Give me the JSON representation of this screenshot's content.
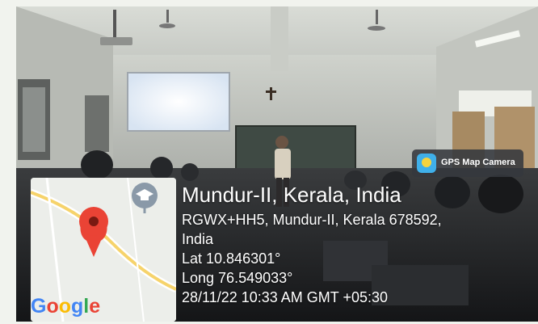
{
  "overlay": {
    "badge_label": "GPS Map Camera",
    "location_title": "Mundur-II, Kerala, India",
    "address_line1": "RGWX+HH5, Mundur-II, Kerala 678592,",
    "address_line2": "India",
    "latitude": "Lat 10.846301°",
    "longitude": "Long 76.549033°",
    "datetime": "28/11/22 10:33 AM GMT +05:30"
  },
  "map": {
    "logo_text": "Google",
    "logo_letters": [
      "G",
      "o",
      "o",
      "g",
      "l",
      "e"
    ],
    "logo_colors": [
      "#4285f4",
      "#ea4335",
      "#fbbc05",
      "#4285f4",
      "#34a853",
      "#ea4335"
    ],
    "pin_color": "#ea4335",
    "road_color": "#f6d36b",
    "marker_icon": "school-icon"
  },
  "colors": {
    "badge_bg": "#34383e",
    "badge_icon": "#3fb0ea",
    "text": "#ffffff"
  }
}
